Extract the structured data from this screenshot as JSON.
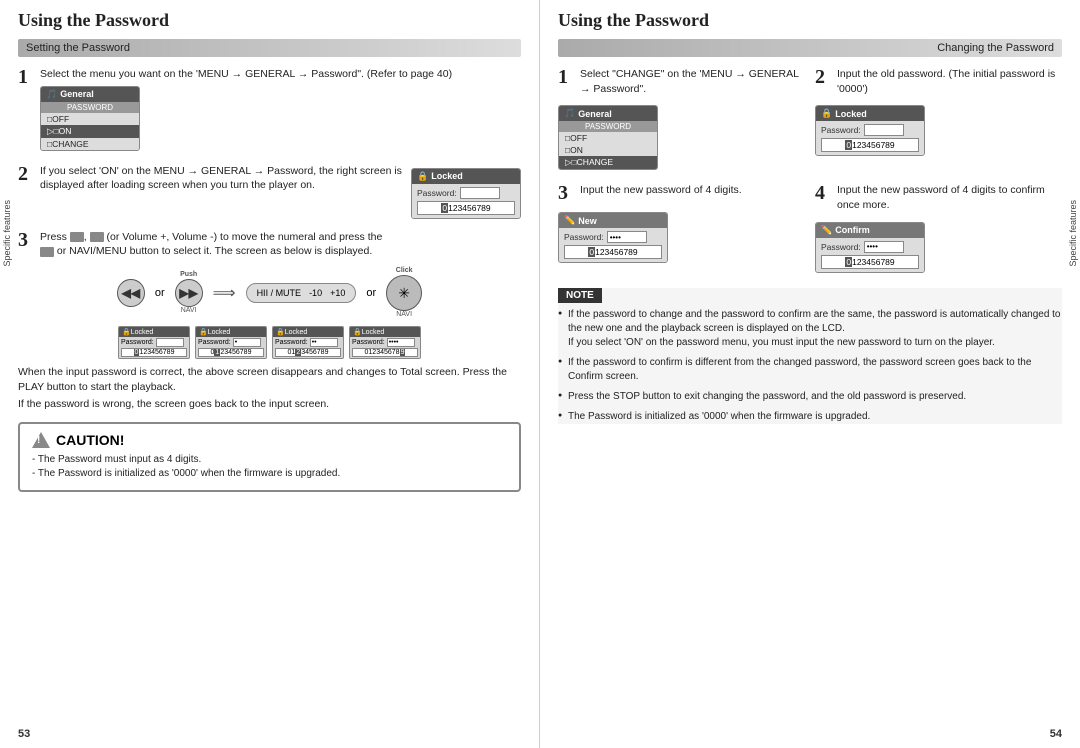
{
  "left_page": {
    "title": "Using the Password",
    "section": "Setting the Password",
    "step1": {
      "number": "1",
      "text": "Select the menu you want on the 'MENU → GENERAL → Password\". (Refer to page 40)",
      "menu": {
        "icon": "🎵",
        "title": "General",
        "subheader": "PASSWORD",
        "items": [
          "□OFF",
          "▷□ON",
          "□CHANGE"
        ]
      }
    },
    "step2": {
      "number": "2",
      "text": "If you select 'ON' on the MENU → GENERAL → Password, the right screen is displayed after loading screen when you turn the player on.",
      "lock": {
        "icon": "🔒",
        "title": "Locked",
        "password_label": "Password:",
        "password_value": "",
        "numpad": "0123456789",
        "selected": "0"
      }
    },
    "step3": {
      "number": "3",
      "text1": "Press",
      "text2": ", ",
      "text3": "(or Volume +, Volume -) to move the numeral and press the",
      "text4": "or NAVI/MENU button to select it. The screen as below is displayed.",
      "push_label": "Push",
      "click_label": "Click",
      "vol_minus": "-10",
      "vol_plus": "+10",
      "mute_label": "HII / MUTE",
      "screens": [
        {
          "title": "Locked",
          "pw": "",
          "numpad": "0123456789",
          "selected": "0"
        },
        {
          "title": "Locked",
          "pw": "•",
          "numpad": "0123456789",
          "selected": "1"
        },
        {
          "title": "Locked",
          "pw": "••",
          "numpad": "0123456789",
          "selected": "2"
        },
        {
          "title": "Locked",
          "pw": "••••",
          "numpad": "0123456789",
          "selected": "9"
        }
      ],
      "note1": "When the input password is correct, the above screen disappears and changes to Total screen. Press the PLAY button to start the playback.",
      "note2": "If the password is wrong, the screen goes back to the input screen."
    },
    "caution": {
      "title": "CAUTION!",
      "items": [
        "- The Password must input as 4 digits.",
        "- The Password is initialized as '0000' when the firmware is upgraded."
      ]
    },
    "page_num": "53"
  },
  "right_page": {
    "title": "Using the Password",
    "section": "Changing the Password",
    "step1": {
      "number": "1",
      "text": "Select \"CHANGE\" on the 'MENU → GENERAL → Password\".",
      "menu": {
        "icon": "🎵",
        "title": "General",
        "subheader": "PASSWORD",
        "items": [
          "□OFF",
          "□ON",
          "▷□CHANGE"
        ]
      }
    },
    "step2": {
      "number": "2",
      "text": "Input the old password. (The initial password is '0000')",
      "lock": {
        "icon": "🔒",
        "title": "Locked",
        "password_label": "Password:",
        "password_value": "",
        "numpad": "0123456789",
        "selected": "0"
      }
    },
    "step3": {
      "number": "3",
      "text": "Input the new password of 4 digits.",
      "lock": {
        "icon": "✏️",
        "title": "New",
        "password_label": "Password:",
        "password_value": "••••",
        "numpad": "0123456789",
        "selected": "0"
      }
    },
    "step4": {
      "number": "4",
      "text": "Input the new password of 4 digits to confirm once more.",
      "lock": {
        "icon": "✏️",
        "title": "Confirm",
        "password_label": "Password:",
        "password_value": "••••",
        "numpad": "0123456789",
        "selected": "0"
      }
    },
    "note": {
      "label": "NOTE",
      "items": [
        "If the password to change and the password to confirm are the same, the password is automatically changed to the new one and the playback screen is displayed on the LCD.\nIf you select 'ON' on the password menu, you must input the new password to turn on the player.",
        "If the password to confirm is different from the changed password, the password screen goes back to the Confirm screen.",
        "Press the STOP button to exit changing the password, and the old password is preserved.",
        "The Password is initialized as '0000' when the firmware is upgraded."
      ]
    },
    "page_num": "54",
    "sidebar_label": "Specific features"
  },
  "left_sidebar_label": "Specific features"
}
